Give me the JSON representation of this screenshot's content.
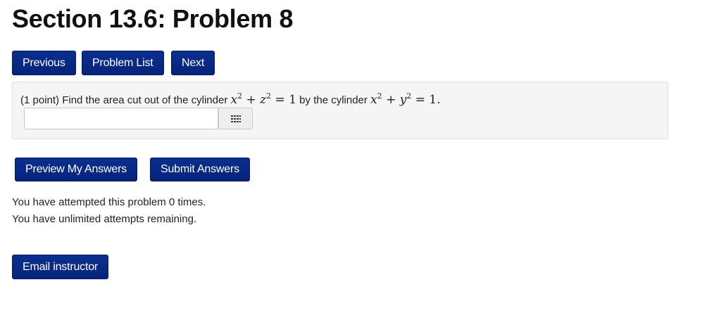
{
  "page": {
    "title": "Section 13.6: Problem 8"
  },
  "nav": {
    "previous": "Previous",
    "problem_list": "Problem List",
    "next": "Next"
  },
  "problem": {
    "prefix": "(1 point) Find the area cut out of the cylinder ",
    "mid": " by the cylinder ",
    "eq1": {
      "a": "x",
      "b": "z",
      "exp": "2",
      "rhs": "1"
    },
    "eq2": {
      "a": "x",
      "b": "y",
      "exp": "2",
      "rhs": "1"
    },
    "answer_value": "",
    "keypad_icon": "keypad-grid-icon"
  },
  "actions": {
    "preview": "Preview My Answers",
    "submit": "Submit Answers"
  },
  "status": {
    "attempts": "You have attempted this problem 0 times.",
    "remaining": "You have unlimited attempts remaining."
  },
  "footer": {
    "email": "Email instructor"
  },
  "colors": {
    "button_bg": "#06237a",
    "button_text": "#ffffff",
    "panel_bg": "#f5f5f5"
  }
}
